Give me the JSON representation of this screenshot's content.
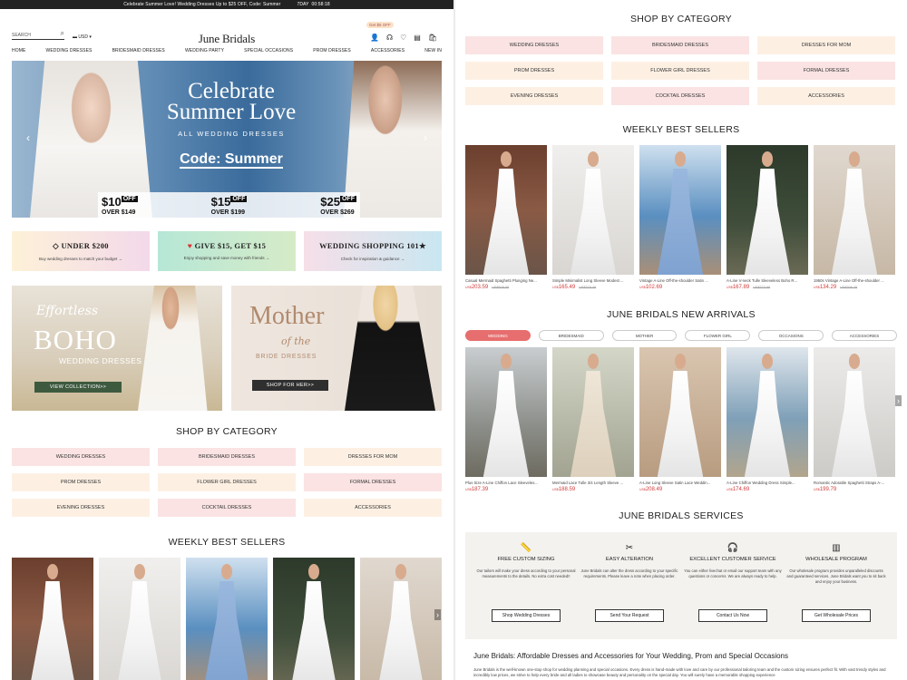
{
  "topbar": {
    "promo": "Celebrate Summer Love! Wedding Dresses Up to $25 OFF, Code: Summer",
    "countdown_label": "7DAY",
    "countdown": "00:58:18"
  },
  "header": {
    "search_placeholder": "SEARCH",
    "currency": "USD",
    "logo": "June Bridals",
    "off_badge": "Get $5 OFF"
  },
  "nav": [
    "HOME",
    "WEDDING DRESSES",
    "BRIDESMAID DRESSES",
    "WEDDING PARTY",
    "SPECIAL OCCASIONS",
    "PROM DRESSES",
    "ACCESSORIES",
    "NEW IN"
  ],
  "hero": {
    "line1": "Celebrate",
    "line2": "Summer Love",
    "sub": "ALL WEDDING DRESSES",
    "code": "Code: Summer",
    "offers": [
      {
        "amount": "$10",
        "tag": "OFF",
        "over": "OVER $149"
      },
      {
        "amount": "$15",
        "tag": "OFF",
        "over": "OVER $199"
      },
      {
        "amount": "$25",
        "tag": "OFF",
        "over": "OVER $269"
      }
    ]
  },
  "promos": [
    {
      "title": "UNDER $200",
      "sub": "Buy wedding dresses to match your budget →"
    },
    {
      "title": "GIVE $15, GET $15",
      "sub": "Enjoy shopping and save money with friends →"
    },
    {
      "title": "WEDDING SHOPPING 101★",
      "sub": "Check for inspiration & guidance →"
    }
  ],
  "banners": {
    "boho": {
      "script": "Effortless",
      "big": "BOHO",
      "sub": "WEDDING DRESSES",
      "button": "VIEW COLLECTION>>"
    },
    "mother": {
      "big": "Mother",
      "script": "of the",
      "sub": "BRIDE DRESSES",
      "button": "SHOP FOR HER>>"
    }
  },
  "shop_by_category": {
    "title": "SHOP BY CATEGORY",
    "items": [
      "WEDDING DRESSES",
      "BRIDESMAID DRESSES",
      "DRESSES FOR MOM",
      "PROM DRESSES",
      "FLOWER GIRL DRESSES",
      "FORMAL DRESSES",
      "EVENING DRESSES",
      "COCKTAIL DRESSES",
      "ACCESSORIES"
    ]
  },
  "best_sellers": {
    "title": "WEEKLY BEST SELLERS",
    "items": [
      {
        "name": "Casual Mermaid Spaghetti Plunging Ne...",
        "cur": "US$",
        "price": "203.59",
        "old": "US$508.59"
      },
      {
        "name": "Simple Minimalist Long Sleeve Modest ...",
        "cur": "US$",
        "price": "165.49",
        "old": "US$379.49"
      },
      {
        "name": "Vintage A-Line Off-the-shoulder Satin ...",
        "cur": "US$",
        "price": "102.69",
        "old": ""
      },
      {
        "name": "A-Line V-neck Tulle Sleeveless Boho R...",
        "cur": "US$",
        "price": "167.89",
        "old": "US$373.89"
      },
      {
        "name": "1950s Vintage A-Line Off-the-shoulder ...",
        "cur": "US$",
        "price": "134.29",
        "old": "US$306.29"
      }
    ]
  },
  "new_arrivals": {
    "title": "JUNE BRIDALS NEW ARRIVALS",
    "tabs": [
      "WEDDING",
      "BRIDESMAID",
      "MOTHER",
      "FLOWER GIRL",
      "OCCASIONS",
      "ACCESSORIES"
    ],
    "items": [
      {
        "name": "Plus Size A-Line Chiffon Lace Sleeveles...",
        "cur": "US$",
        "price": "187.39"
      },
      {
        "name": "Mermaid Lace Tulle 3/4 Length Sleeve ...",
        "cur": "US$",
        "price": "188.59"
      },
      {
        "name": "A-Line Long Sleeve Satin Lace Weddin...",
        "cur": "US$",
        "price": "208.49"
      },
      {
        "name": "A-Line Chiffon Wedding Dress Simple...",
        "cur": "US$",
        "price": "174.69"
      },
      {
        "name": "Romantic Adorable Spaghetti Straps A-...",
        "cur": "US$",
        "price": "199.79"
      }
    ]
  },
  "services": {
    "title": "JUNE BRIDALS SERVICES",
    "items": [
      {
        "icon": "ruler-icon",
        "title": "FREE CUSTOM SIZING",
        "desc": "Our tailors will make your dress according to your personal measurements to the details. No extra cost needed!!",
        "button": "Shop Wedding Dresses"
      },
      {
        "icon": "scissors-icon",
        "title": "EASY ALTERATION",
        "desc": "June Bridals can alter the dress according to your specific requirements. Please leave a note when placing order.",
        "button": "Send Your Request"
      },
      {
        "icon": "headset-icon",
        "title": "EXCELLENT CUSTOMER SERVICE",
        "desc": "You can either livechat or email our support team with any questions or concerns. We are always ready to help.",
        "button": "Contact Us Now"
      },
      {
        "icon": "warehouse-icon",
        "title": "WHOLESALE PROGRAM",
        "desc": "Our wholesale program provides unparalleled discounts and guaranteed services. June Bridals want you to sit back and enjoy your business.",
        "button": "Get Wholesale Prices"
      }
    ]
  },
  "about": {
    "title": "June Bridals: Affordable Dresses and Accessories for Your Wedding, Prom and Special Occasions",
    "text": "June Bridals is the well-known one-stop shop for wedding planning and special occasions. Every dress is hand-made with love and care by our professional tailoring team and the custom sizing ensures perfect fit. With vast trendy styles and incredibly low prices, we strive to help every bride and all ladies to showcase beauty and personality on the special day. You will surely have a memorable shopping experience"
  },
  "colors": {
    "pink": "#fbe3e3",
    "peach": "#fdf0e3",
    "accent": "#e76e6e",
    "price": "#d23b3b"
  }
}
